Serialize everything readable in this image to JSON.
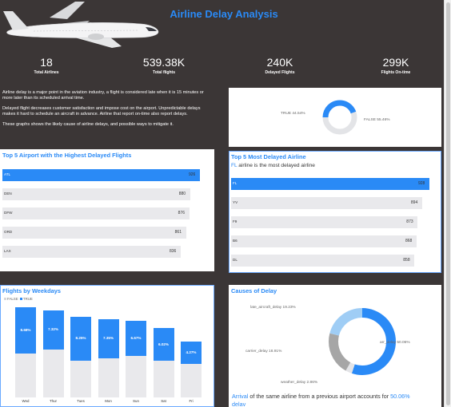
{
  "header": {
    "title": "Airline Delay Analysis"
  },
  "kpis": [
    {
      "value": "18",
      "label": "Total Airlines"
    },
    {
      "value": "539.38K",
      "label": "Total flights"
    },
    {
      "value": "240K",
      "label": "Delayed Flights"
    },
    {
      "value": "299K",
      "label": "Flights On-time"
    }
  ],
  "intro": {
    "p1": "Airline delay is a major point in the aviation industry, a flight is considered late when it is 15 minutes or more later than its scheduled arrival time.",
    "p2": "Delayed flight decreases customer satisfaction and impose cost on the airport. Unpredictable delays makes it hard to schedule an aircraft in advance.  Airline that report on-time also report delays.",
    "p3": "These graphs shows the likely cause of airline delays, and possible ways to mitigate it."
  },
  "colors": {
    "accent": "#2a8af6",
    "track": "#e9e9ec",
    "dark": "#3b3636",
    "light_blue": "#9fcdf5",
    "gray": "#a6a6a6"
  },
  "chart_data": [
    {
      "type": "pie",
      "title": "",
      "categories": [
        "TRUE",
        "FALSE"
      ],
      "values": [
        44.54,
        55.46
      ],
      "labels": [
        "TRUE 44.54%",
        "FALSE 55.46%"
      ]
    },
    {
      "type": "bar",
      "title": "Top 5 Airport with the Highest Delayed Flights",
      "categories": [
        "ATL",
        "DEN",
        "DFW",
        "ORD",
        "LAX"
      ],
      "values": [
        926,
        880,
        876,
        861,
        836
      ],
      "xlim": [
        0,
        1000
      ]
    },
    {
      "type": "bar",
      "title": "Top 5 Most Delayed Airline",
      "subtitle": "airline is the most delayed airline",
      "highlight": "FL",
      "categories": [
        "FL",
        "YV",
        "F9",
        "B6",
        "DL"
      ],
      "values": [
        928,
        894,
        873,
        868,
        858
      ],
      "xlim": [
        0,
        1000
      ]
    },
    {
      "type": "bar",
      "title": "Flights by Weekdays",
      "legend": {
        "false_label": "FALSE",
        "true_label": "TRUE"
      },
      "categories": [
        "Wed",
        "Thur",
        "Tues",
        "Mon",
        "Sun",
        "Sat",
        "Fri"
      ],
      "values": [
        8.68,
        7.32,
        8.25,
        7.35,
        6.67,
        6.02,
        4.27
      ],
      "labels": [
        "8.68%",
        "7.32%",
        "8.25%",
        "7.35%",
        "6.67%",
        "6.02%",
        "4.27%"
      ],
      "totals": [
        16.93,
        16.37,
        15.15,
        14.71,
        14.45,
        12.96,
        10.5
      ]
    },
    {
      "type": "pie",
      "title": "Causes of Delay",
      "categories": [
        "arr_delay",
        "weather_delay",
        "carrier_delay",
        "late_aircraft_delay"
      ],
      "values": [
        50.06,
        2.86,
        18.91,
        19.23
      ],
      "labels": [
        "arr_delay 50.06%",
        "weather_delay 2.86%",
        "carrier_delay 18.91%",
        "late_aircraft_delay 19.23%"
      ]
    }
  ],
  "causes_note": {
    "lead": "Arrival",
    "middle": " of the same airline from a previous airport accounts for ",
    "pct": "50.06%",
    "tail": "delay"
  }
}
